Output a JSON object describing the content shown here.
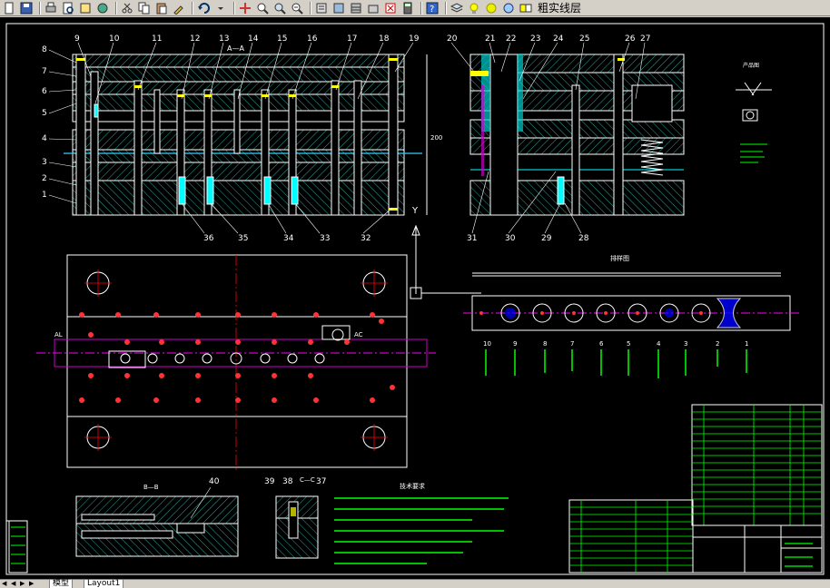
{
  "toolbar": {
    "layer_name": "粗实线层",
    "icons": [
      "new-icon",
      "save-icon",
      "print-icon",
      "preview-icon",
      "publish-icon",
      "plot-icon",
      "cut-icon",
      "copy-icon",
      "paste-icon",
      "match-prop-icon",
      "undo-icon",
      "pan-icon",
      "zoom-realtime-icon",
      "zoom-window-icon",
      "zoom-previous-icon",
      "properties-icon",
      "designcenter-icon",
      "toolpalette-icon",
      "sheetset-icon",
      "markup-icon",
      "calc-icon",
      "help-icon",
      "layer-icon",
      "bulb-icon",
      "sun-icon",
      "lock-icon",
      "color-icon"
    ]
  },
  "tabs": {
    "model_label": "模型",
    "layout_label": "Layout1"
  },
  "drawing": {
    "section_label_aa": "A—A",
    "section_label_bb": "B—B",
    "section_label_cc": "C—C",
    "strip_title": "排样图",
    "product_title": "产品图",
    "notes_title": "技术要求",
    "part_numbers_top": [
      "9",
      "10",
      "11",
      "12",
      "13",
      "14",
      "15",
      "16",
      "17",
      "18",
      "19",
      "20",
      "21",
      "22",
      "23",
      "24",
      "25",
      "26",
      "27"
    ],
    "part_numbers_left": [
      "8",
      "7",
      "6",
      "5",
      "4",
      "3",
      "2",
      "1"
    ],
    "part_numbers_bottom": [
      "36",
      "35",
      "34",
      "33",
      "32",
      "31",
      "30",
      "29",
      "28"
    ],
    "part_numbers_detail": [
      "40",
      "39",
      "38",
      "37"
    ],
    "station_numbers": [
      "10",
      "9",
      "8",
      "7",
      "6",
      "5",
      "4",
      "3",
      "2",
      "1"
    ]
  }
}
